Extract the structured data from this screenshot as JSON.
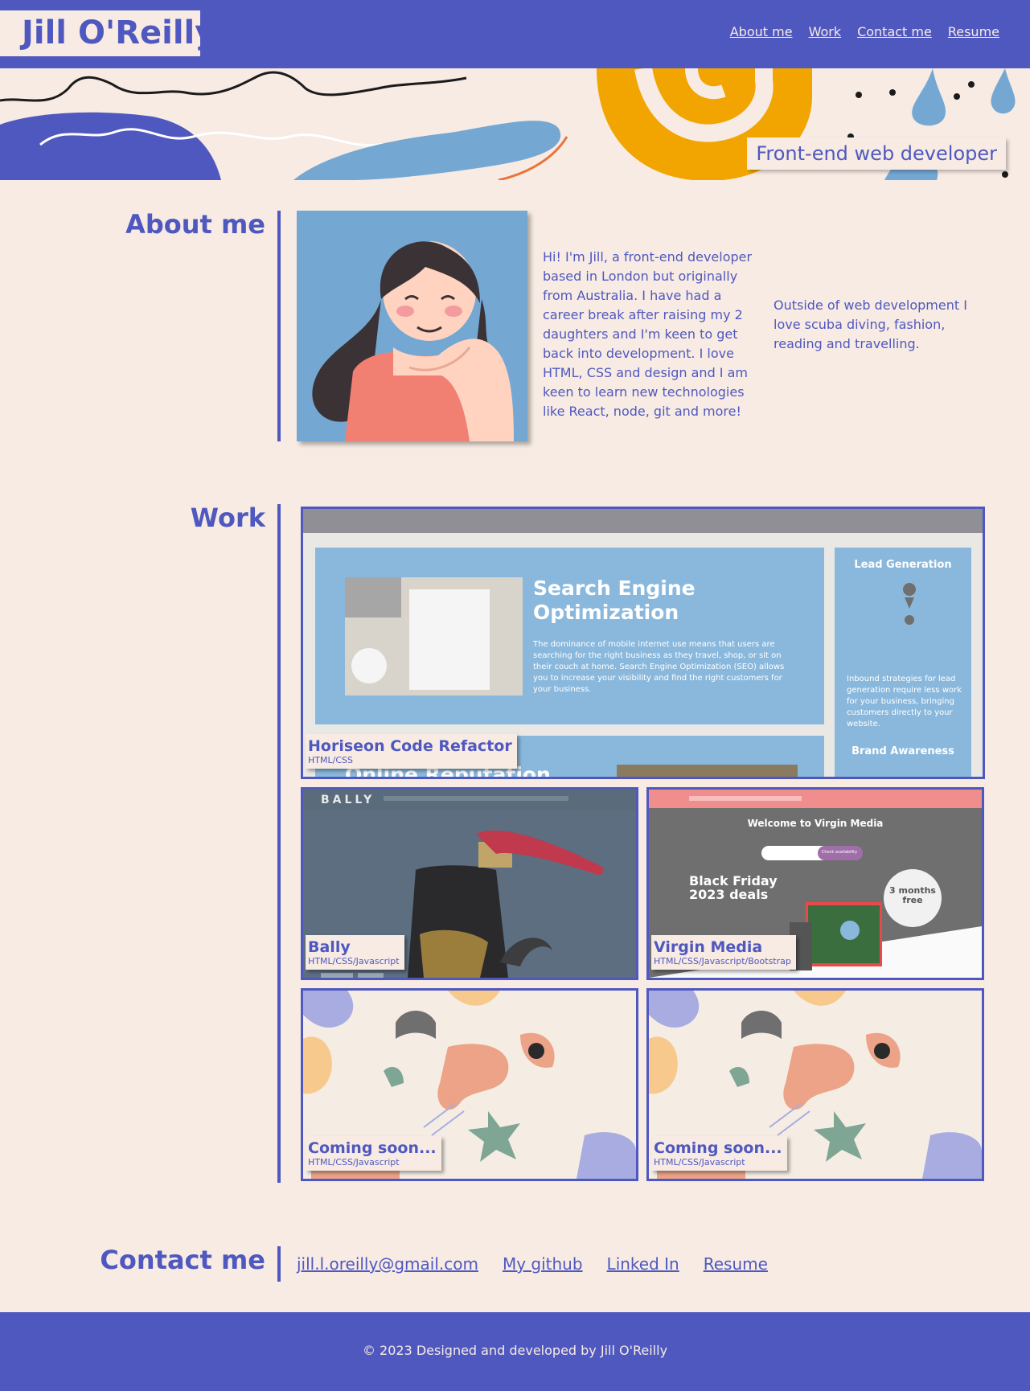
{
  "header": {
    "logo": "Jill O'Reilly",
    "nav": [
      "About me",
      "Work",
      "Contact me",
      "Resume"
    ]
  },
  "hero": {
    "tagline": "Front-end web developer"
  },
  "about": {
    "title": "About me",
    "paragraph1": "Hi! I'm Jill, a front-end developer based in London but originally from Australia. I have had a career break after raising my 2 daughters and I'm keen to get back into development. I love HTML, CSS and design and I am keen to learn new technologies like React, node, git and more!",
    "paragraph2": "Outside of web development I love scuba diving, fashion, reading and travelling."
  },
  "work": {
    "title": "Work",
    "projects": [
      {
        "title": "Horiseon Code Refactor",
        "tech": "HTML/CSS",
        "preview": {
          "heading": "Search Engine Optimization",
          "body": "The dominance of mobile internet use means that users are searching for the right business as they travel, shop, or sit on their couch at home. Search Engine Optimization (SEO) allows you to increase your visibility and find the right customers for your business.",
          "side_top": "Lead Generation",
          "side_text": "Inbound strategies for lead generation require less work for your business, bringing customers directly to your website.",
          "side_bottom": "Brand Awareness",
          "cut_heading": "Online Reputation"
        }
      },
      {
        "title": "Bally",
        "tech": "HTML/CSS/Javascript",
        "preview": {
          "brand": "BALLY"
        }
      },
      {
        "title": "Virgin Media",
        "tech": "HTML/CSS/Javascript/Bootstrap",
        "preview": {
          "welcome": "Welcome to Virgin Media",
          "deal": "Black Friday 2023 deals",
          "badge": "3 months free",
          "check": "Check availability"
        }
      },
      {
        "title": "Coming soon...",
        "tech": "HTML/CSS/Javascript"
      },
      {
        "title": "Coming soon...",
        "tech": "HTML/CSS/Javascript"
      }
    ]
  },
  "contact": {
    "title": "Contact me",
    "links": [
      "jill.l.oreilly@gmail.com",
      "My github",
      "Linked In",
      "Resume"
    ]
  },
  "footer": {
    "text": "© 2023 Designed and developed by Jill O'Reilly"
  },
  "colors": {
    "primary": "#4f58bf",
    "background": "#f7ebe4",
    "orange": "#f2a500",
    "sky": "#74a8d3"
  }
}
